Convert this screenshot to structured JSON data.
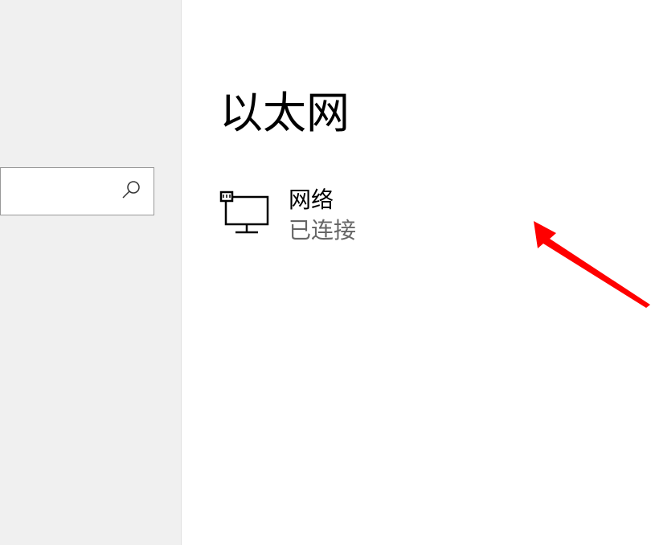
{
  "sidebar": {
    "search": {
      "placeholder": ""
    }
  },
  "main": {
    "title": "以太网",
    "network": {
      "name": "网络",
      "status": "已连接"
    }
  },
  "annotation": {
    "arrow_color": "#ff0000"
  }
}
